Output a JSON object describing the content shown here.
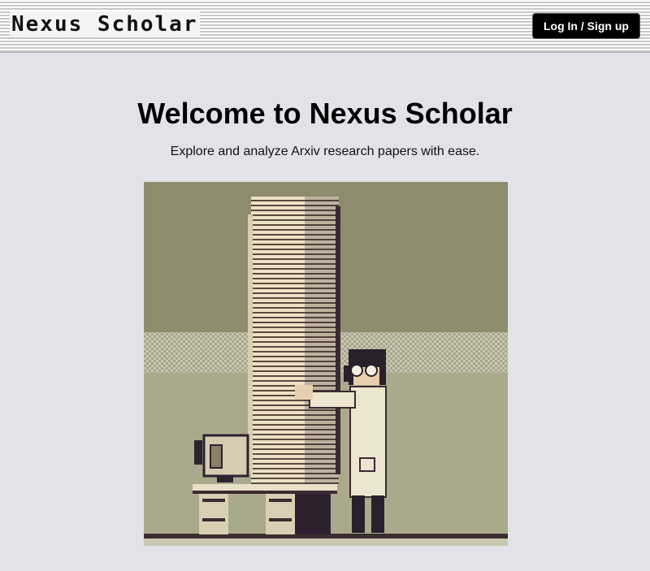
{
  "header": {
    "logo_text": "Nexus Scholar",
    "login_label": "Log In / Sign up"
  },
  "main": {
    "title": "Welcome to Nexus Scholar",
    "subtitle": "Explore and analyze Arxiv research papers with ease."
  },
  "colors": {
    "background": "#e2e3e8",
    "button_bg": "#000000",
    "button_text": "#ffffff",
    "illustration_wall": "#8f8c6e",
    "illustration_floor": "#a9aa8c",
    "paper": "#e6dcc0"
  },
  "hero_image": {
    "icon": "scientist-with-paper-stack-illustration"
  }
}
